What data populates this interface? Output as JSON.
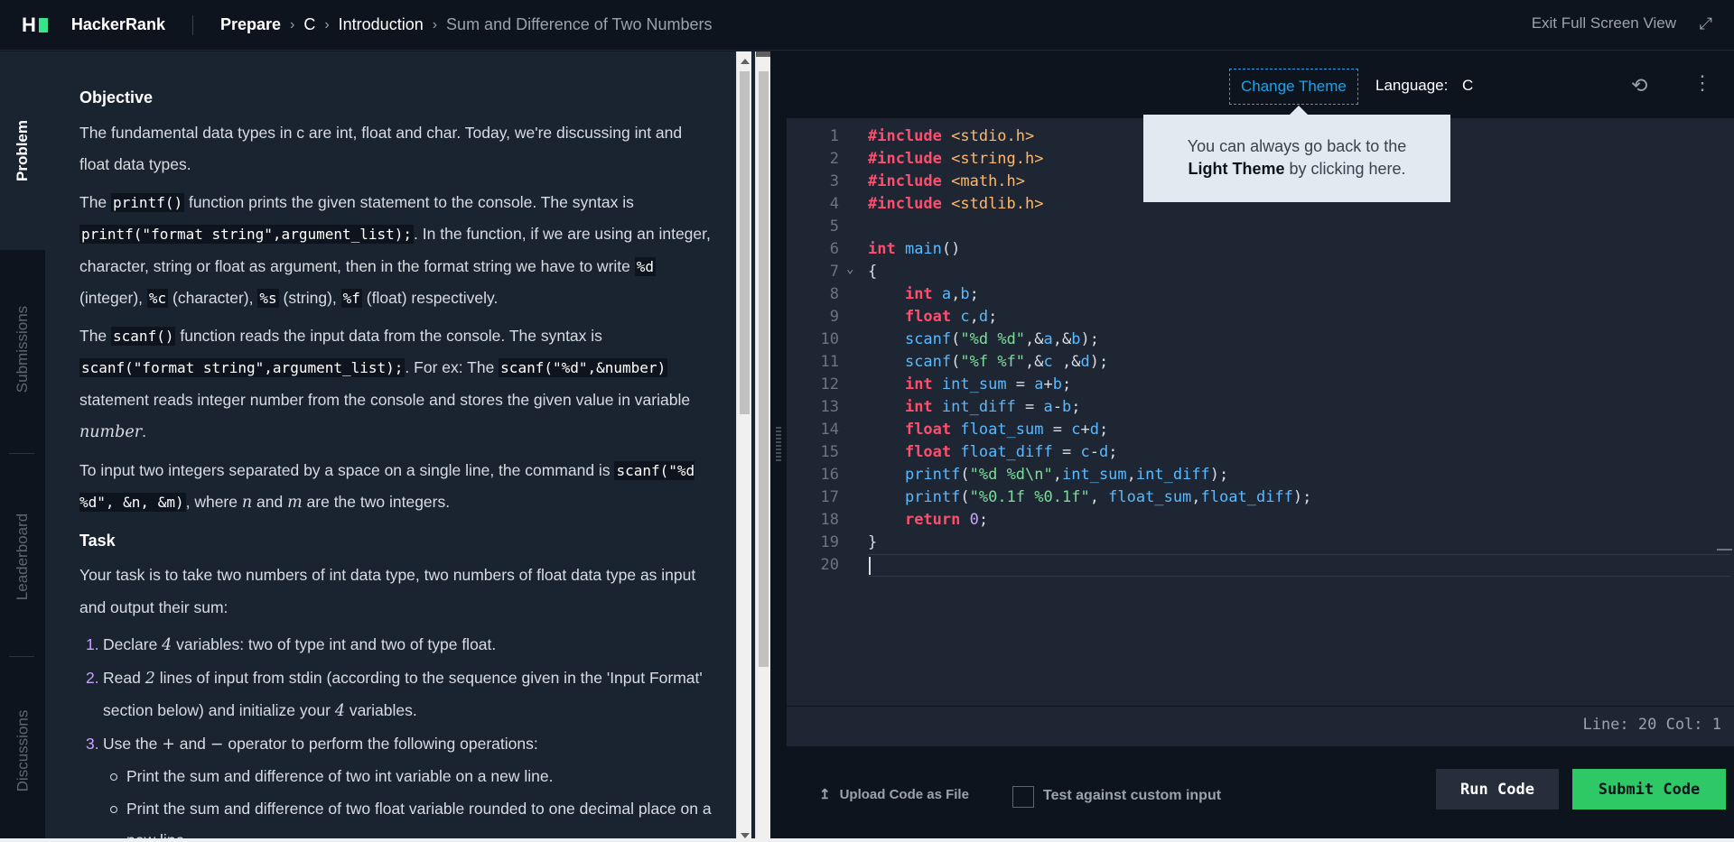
{
  "topbar": {
    "logo_letter": "H",
    "brand": "HackerRank",
    "breadcrumb": [
      "Prepare",
      "C",
      "Introduction",
      "Sum and Difference of Two Numbers"
    ],
    "exit_fullscreen": "Exit Full Screen View"
  },
  "sidetabs": [
    "Problem",
    "Submissions",
    "Leaderboard",
    "Discussions"
  ],
  "problem": {
    "objective_heading": "Objective",
    "p1": "The fundamental data types in c are int, float and char. Today, we're discussing int and float data types.",
    "p2_a": "The ",
    "p2_code1": "printf()",
    "p2_b": " function prints the given statement to the console. The syntax is ",
    "p2_code2": "printf(\"format string\",argument_list);",
    "p2_c": ". In the function, if we are using an integer, character, string or float as argument, then in the format string we have to write ",
    "p2_code3": "%d",
    "p2_d": " (integer), ",
    "p2_code4": "%c",
    "p2_e": " (character), ",
    "p2_code5": "%s",
    "p2_f": " (string), ",
    "p2_code6": "%f",
    "p2_g": " (float) respectively.",
    "p3_a": "The ",
    "p3_code1": "scanf()",
    "p3_b": " function reads the input data from the console. The syntax is ",
    "p3_code2": "scanf(\"format string\",argument_list);",
    "p3_c": ". For ex: The ",
    "p3_code3": "scanf(\"%d\",&number)",
    "p3_d": " statement reads integer number from the console and stores the given value in variable ",
    "p3_math": "number",
    "p3_e": ".",
    "p4_a": "To input two integers separated by a space on a single line, the command is ",
    "p4_code": "scanf(\"%d %d\", &n, &m)",
    "p4_b": ", where ",
    "p4_n": "n",
    "p4_c": " and ",
    "p4_m": "m",
    "p4_d": " are the two integers.",
    "task_heading": "Task",
    "task_intro": "Your task is to take two numbers of int data type, two numbers of float data type as input and output their sum:",
    "steps": [
      {
        "num": "1.",
        "a": "Declare ",
        "math": "4",
        "b": " variables: two of type int and two of type float."
      },
      {
        "num": "2.",
        "a": "Read ",
        "math": "2",
        "b": " lines of input from stdin (according to the sequence given in the 'Input Format' section below) and initialize your ",
        "math2": "4",
        "c": " variables."
      },
      {
        "num": "3.",
        "a": "Use the ",
        "math": "+",
        "b": " and ",
        "math2": "−",
        "c": " operator to perform the following operations:"
      }
    ],
    "substeps": [
      "Print the sum and difference of two int variable on a new line.",
      "Print the sum and difference of two float variable rounded to one decimal place on a new line."
    ]
  },
  "editor": {
    "change_theme": "Change Theme",
    "language_label": "Language:",
    "language_value": "C",
    "tooltip_a": "You can always go back to the",
    "tooltip_bold": "Light Theme",
    "tooltip_b": " by clicking here.",
    "status": "Line: 20 Col: 1"
  },
  "code_lines": [
    [
      {
        "t": "#include ",
        "c": "inc"
      },
      {
        "t": "<stdio.h>",
        "c": "hdr"
      }
    ],
    [
      {
        "t": "#include ",
        "c": "inc"
      },
      {
        "t": "<string.h>",
        "c": "hdr"
      }
    ],
    [
      {
        "t": "#include ",
        "c": "inc"
      },
      {
        "t": "<math.h>",
        "c": "hdr"
      }
    ],
    [
      {
        "t": "#include ",
        "c": "inc"
      },
      {
        "t": "<stdlib.h>",
        "c": "hdr"
      }
    ],
    [],
    [
      {
        "t": "int ",
        "c": "kw"
      },
      {
        "t": "main",
        "c": "fn"
      },
      {
        "t": "()",
        "c": ""
      }
    ],
    [
      {
        "t": "{",
        "c": ""
      }
    ],
    [
      {
        "t": "    ",
        "c": ""
      },
      {
        "t": "int ",
        "c": "kw"
      },
      {
        "t": "a",
        "c": "var"
      },
      {
        "t": ",",
        "c": ""
      },
      {
        "t": "b",
        "c": "var"
      },
      {
        "t": ";",
        "c": ""
      }
    ],
    [
      {
        "t": "    ",
        "c": ""
      },
      {
        "t": "float ",
        "c": "kw"
      },
      {
        "t": "c",
        "c": "var"
      },
      {
        "t": ",",
        "c": ""
      },
      {
        "t": "d",
        "c": "var"
      },
      {
        "t": ";",
        "c": ""
      }
    ],
    [
      {
        "t": "    ",
        "c": ""
      },
      {
        "t": "scanf",
        "c": "fn"
      },
      {
        "t": "(",
        "c": ""
      },
      {
        "t": "\"%d %d\"",
        "c": "str"
      },
      {
        "t": ",&",
        "c": ""
      },
      {
        "t": "a",
        "c": "var"
      },
      {
        "t": ",&",
        "c": ""
      },
      {
        "t": "b",
        "c": "var"
      },
      {
        "t": ");",
        "c": ""
      }
    ],
    [
      {
        "t": "    ",
        "c": ""
      },
      {
        "t": "scanf",
        "c": "fn"
      },
      {
        "t": "(",
        "c": ""
      },
      {
        "t": "\"%f %f\"",
        "c": "str"
      },
      {
        "t": ",&",
        "c": ""
      },
      {
        "t": "c",
        "c": "var"
      },
      {
        "t": " ,&",
        "c": ""
      },
      {
        "t": "d",
        "c": "var"
      },
      {
        "t": ");",
        "c": ""
      }
    ],
    [
      {
        "t": "    ",
        "c": ""
      },
      {
        "t": "int ",
        "c": "kw"
      },
      {
        "t": "int_sum",
        "c": "var"
      },
      {
        "t": " = ",
        "c": ""
      },
      {
        "t": "a",
        "c": "var"
      },
      {
        "t": "+",
        "c": ""
      },
      {
        "t": "b",
        "c": "var"
      },
      {
        "t": ";",
        "c": ""
      }
    ],
    [
      {
        "t": "    ",
        "c": ""
      },
      {
        "t": "int ",
        "c": "kw"
      },
      {
        "t": "int_diff",
        "c": "var"
      },
      {
        "t": " = ",
        "c": ""
      },
      {
        "t": "a",
        "c": "var"
      },
      {
        "t": "-",
        "c": ""
      },
      {
        "t": "b",
        "c": "var"
      },
      {
        "t": ";",
        "c": ""
      }
    ],
    [
      {
        "t": "    ",
        "c": ""
      },
      {
        "t": "float ",
        "c": "kw"
      },
      {
        "t": "float_sum",
        "c": "var"
      },
      {
        "t": " = ",
        "c": ""
      },
      {
        "t": "c",
        "c": "var"
      },
      {
        "t": "+",
        "c": ""
      },
      {
        "t": "d",
        "c": "var"
      },
      {
        "t": ";",
        "c": ""
      }
    ],
    [
      {
        "t": "    ",
        "c": ""
      },
      {
        "t": "float ",
        "c": "kw"
      },
      {
        "t": "float_diff",
        "c": "var"
      },
      {
        "t": " = ",
        "c": ""
      },
      {
        "t": "c",
        "c": "var"
      },
      {
        "t": "-",
        "c": ""
      },
      {
        "t": "d",
        "c": "var"
      },
      {
        "t": ";",
        "c": ""
      }
    ],
    [
      {
        "t": "    ",
        "c": ""
      },
      {
        "t": "printf",
        "c": "fn"
      },
      {
        "t": "(",
        "c": ""
      },
      {
        "t": "\"%d %d\\n\"",
        "c": "str"
      },
      {
        "t": ",",
        "c": ""
      },
      {
        "t": "int_sum",
        "c": "var"
      },
      {
        "t": ",",
        "c": ""
      },
      {
        "t": "int_diff",
        "c": "var"
      },
      {
        "t": ");",
        "c": ""
      }
    ],
    [
      {
        "t": "    ",
        "c": ""
      },
      {
        "t": "printf",
        "c": "fn"
      },
      {
        "t": "(",
        "c": ""
      },
      {
        "t": "\"%0.1f %0.1f\"",
        "c": "str"
      },
      {
        "t": ", ",
        "c": ""
      },
      {
        "t": "float_sum",
        "c": "var"
      },
      {
        "t": ",",
        "c": ""
      },
      {
        "t": "float_diff",
        "c": "var"
      },
      {
        "t": ");",
        "c": ""
      }
    ],
    [
      {
        "t": "    ",
        "c": ""
      },
      {
        "t": "return ",
        "c": "kw"
      },
      {
        "t": "0",
        "c": "num"
      },
      {
        "t": ";",
        "c": ""
      }
    ],
    [
      {
        "t": "}",
        "c": ""
      }
    ],
    []
  ],
  "footer": {
    "upload": "Upload Code as File",
    "custom_input": "Test against custom input",
    "run": "Run Code",
    "submit": "Submit Code"
  }
}
